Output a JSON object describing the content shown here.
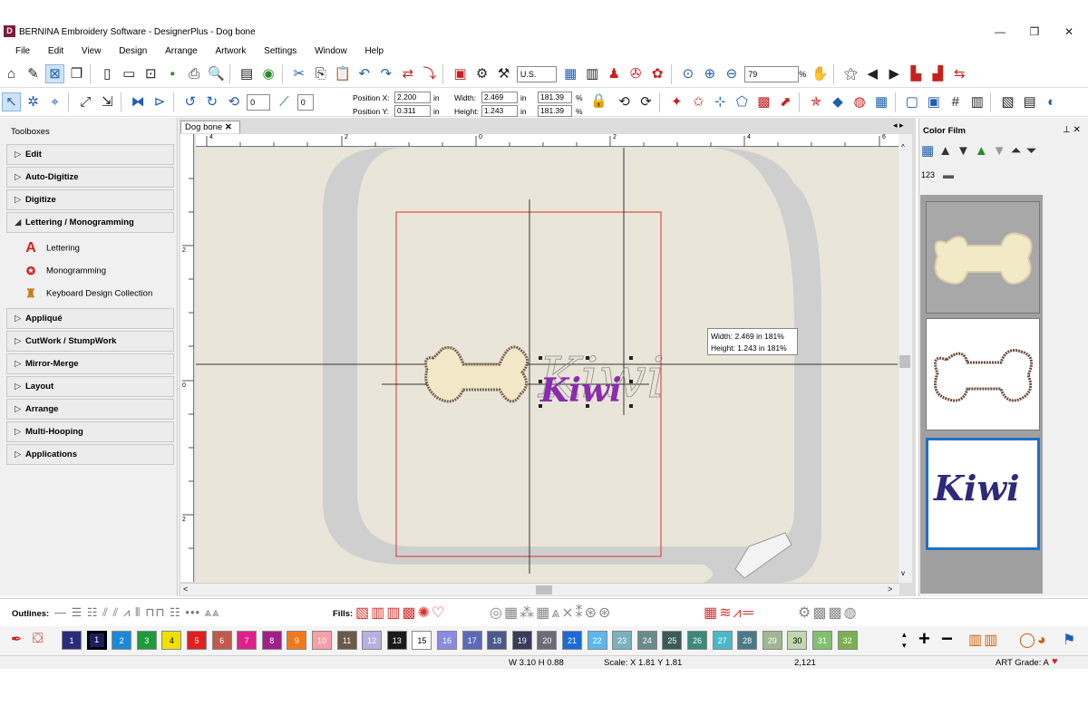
{
  "window": {
    "title": "BERNINA Embroidery Software - DesignerPlus - Dog bone",
    "minimize_glyph": "—",
    "restore_glyph": "❐",
    "close_glyph": "✕"
  },
  "menu": [
    "File",
    "Edit",
    "View",
    "Design",
    "Arrange",
    "Artwork",
    "Settings",
    "Window",
    "Help"
  ],
  "toolbar1": {
    "units": "U.S.",
    "zoom": "79",
    "zoom_unit": "%"
  },
  "toolbar2": {
    "rotate_left_label": "45",
    "rotate_right_label": "45",
    "angle_value": "0",
    "slant_value": "0",
    "position_x_label": "Position X:",
    "position_x": "2.200",
    "position_y_label": "Position Y:",
    "position_y": "0.311",
    "unit_in": "in",
    "width_label": "Width:",
    "width": "2.469",
    "height_label": "Height:",
    "height": "1.243",
    "width_pct": "181.39",
    "height_pct": "181.39",
    "pct": "%",
    "rot15_a": "15",
    "rot15_b": "15"
  },
  "toolboxes": {
    "title": "Toolboxes",
    "sections": [
      {
        "label": "Edit",
        "expanded": false
      },
      {
        "label": "Auto-Digitize",
        "expanded": false
      },
      {
        "label": "Digitize",
        "expanded": false
      },
      {
        "label": "Lettering / Monogramming",
        "expanded": true
      },
      {
        "label": "Appliqué",
        "expanded": false
      },
      {
        "label": "CutWork / StumpWork",
        "expanded": false
      },
      {
        "label": "Mirror-Merge",
        "expanded": false
      },
      {
        "label": "Layout",
        "expanded": false
      },
      {
        "label": "Arrange",
        "expanded": false
      },
      {
        "label": "Multi-Hooping",
        "expanded": false
      },
      {
        "label": "Applications",
        "expanded": false
      }
    ],
    "lettering_items": [
      "Lettering",
      "Monogramming",
      "Keyboard Design Collection"
    ]
  },
  "document": {
    "tab_label": "Dog bone",
    "tab_close": "✕",
    "ruler_h": [
      "4",
      "2",
      "0",
      "2",
      "4",
      "6"
    ],
    "ruler_v": [
      "2",
      "0",
      "2"
    ],
    "design_text": "Kiwi",
    "tooltip_width": "Width: 2.469 in 181%",
    "tooltip_height": "Height: 1.243 in 181%"
  },
  "color_film": {
    "title": "Color Film",
    "sequence_label": "123",
    "items": [
      {
        "name": "bone-fill",
        "selected": false
      },
      {
        "name": "bone-outline",
        "selected": false
      },
      {
        "name": "kiwi-lettering",
        "selected": true,
        "text": "Kiwi"
      }
    ]
  },
  "outlines_bar": {
    "outlines_label": "Outlines:",
    "fills_label": "Fills:"
  },
  "palette": {
    "swatches": [
      {
        "n": "1",
        "color": "#2a2a7a"
      },
      {
        "n": "1",
        "color": "#1d1d5e"
      },
      {
        "n": "2",
        "color": "#1e88d8"
      },
      {
        "n": "3",
        "color": "#1f9a3a"
      },
      {
        "n": "4",
        "color": "#f0e000"
      },
      {
        "n": "5",
        "color": "#e02020"
      },
      {
        "n": "6",
        "color": "#c05a4a"
      },
      {
        "n": "7",
        "color": "#e0208a"
      },
      {
        "n": "8",
        "color": "#a0208a"
      },
      {
        "n": "9",
        "color": "#f07a1a"
      },
      {
        "n": "10",
        "color": "#f5a0a8"
      },
      {
        "n": "11",
        "color": "#6a5a4a"
      },
      {
        "n": "12",
        "color": "#b8b0e0"
      },
      {
        "n": "13",
        "color": "#1a1a1a"
      },
      {
        "n": "15",
        "color": "#ffffff"
      },
      {
        "n": "16",
        "color": "#8a8ae0"
      },
      {
        "n": "17",
        "color": "#5a6ab8"
      },
      {
        "n": "18",
        "color": "#4a5a8a"
      },
      {
        "n": "19",
        "color": "#3a3a5a"
      },
      {
        "n": "20",
        "color": "#6a6a7a"
      },
      {
        "n": "21",
        "color": "#1a6ad8"
      },
      {
        "n": "22",
        "color": "#5ab8f0"
      },
      {
        "n": "23",
        "color": "#7ab0c0"
      },
      {
        "n": "24",
        "color": "#6a8a8a"
      },
      {
        "n": "25",
        "color": "#3a5a5a"
      },
      {
        "n": "26",
        "color": "#3a8a7a"
      },
      {
        "n": "27",
        "color": "#4ab8c8"
      },
      {
        "n": "28",
        "color": "#4a7a8a"
      },
      {
        "n": "29",
        "color": "#a0b890"
      },
      {
        "n": "30",
        "color": "#c0d8b0"
      },
      {
        "n": "31",
        "color": "#80c070"
      },
      {
        "n": "32",
        "color": "#7ab050"
      }
    ]
  },
  "status": {
    "size": "W 3.10 H 0.88",
    "scale": "Scale: X  1.81 Y  1.81",
    "stitches": "2,121",
    "art_grade": "ART Grade: A",
    "heart": "♥"
  },
  "colors": {
    "accent": "#1e5fb0",
    "hoop_red": "#d8332f",
    "lettering_purple": "#8b2bb0",
    "selected_frame": "#1f6fc8"
  }
}
